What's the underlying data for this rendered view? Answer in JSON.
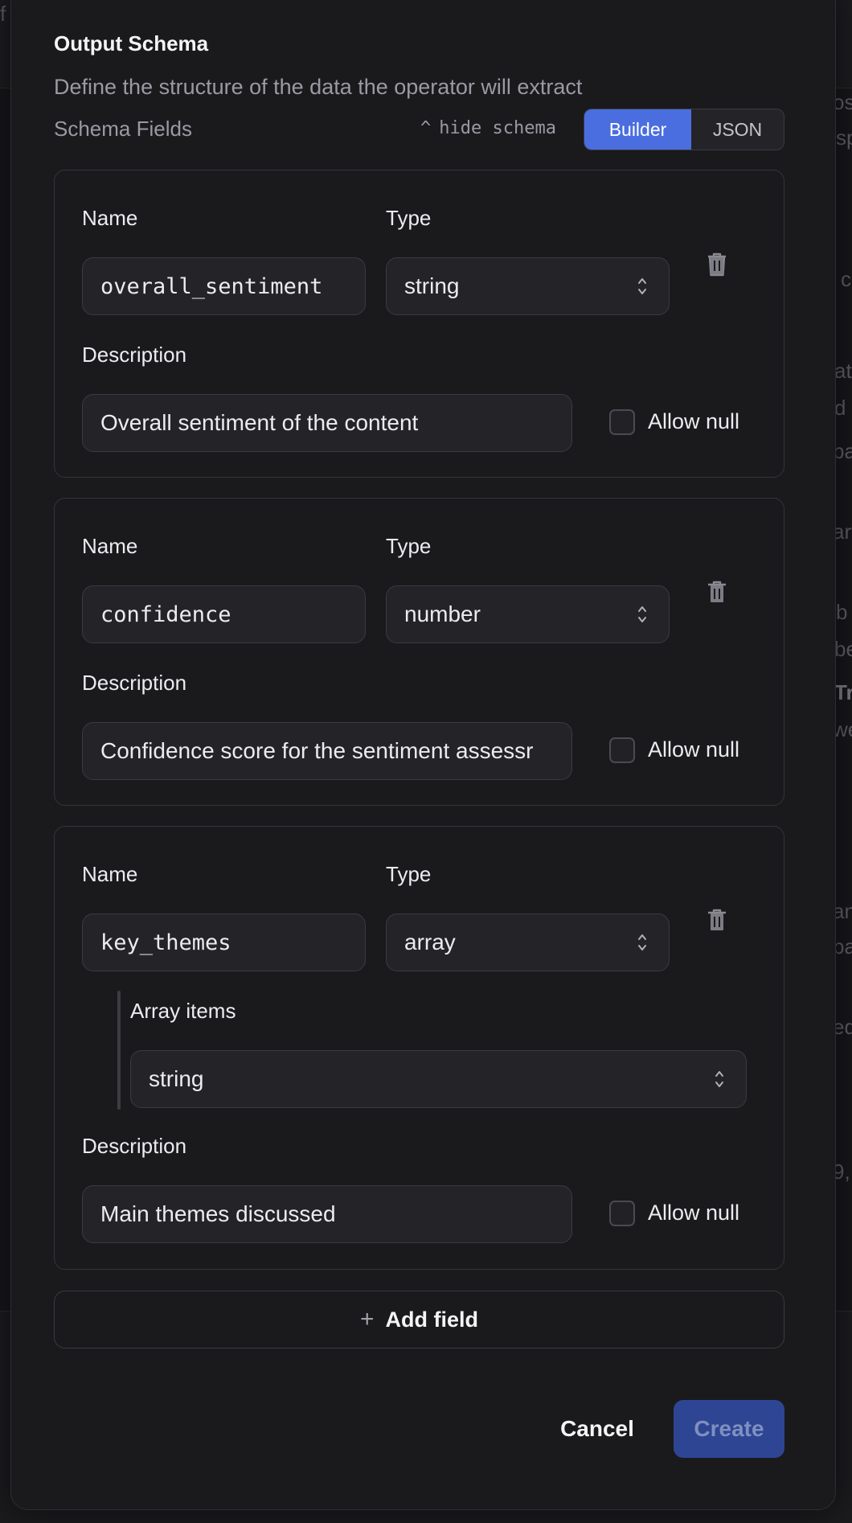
{
  "background": {
    "fragments": [
      "f",
      "os",
      "sp",
      "c",
      "at",
      "d",
      "pa",
      "art",
      "b",
      "be",
      "Tr",
      "we",
      "an",
      "pa",
      "ed",
      "9,"
    ]
  },
  "schema": {
    "title": "Output Schema",
    "description": "Define the structure of the data the operator will extract",
    "fields_label": "Schema Fields",
    "hide_schema": "hide schema",
    "hide_caret": "^",
    "modes": {
      "builder": "Builder",
      "json": "JSON",
      "active": "Builder"
    }
  },
  "labels": {
    "name": "Name",
    "type": "Type",
    "description": "Description",
    "allow_null": "Allow null",
    "array_items": "Array items"
  },
  "fields": [
    {
      "name": "overall_sentiment",
      "type": "string",
      "description": "Overall sentiment of the content",
      "allow_null": false
    },
    {
      "name": "confidence",
      "type": "number",
      "description": "Confidence score for the sentiment assessr",
      "allow_null": false
    },
    {
      "name": "key_themes",
      "type": "array",
      "array_items_type": "string",
      "description": "Main themes discussed",
      "allow_null": false
    }
  ],
  "actions": {
    "add_field": "Add field",
    "add_icon": "+",
    "cancel": "Cancel",
    "create": "Create"
  },
  "colors": {
    "accent": "#4a6ee0",
    "create_disabled": "#2d4593",
    "modal_bg": "#1a1a1d"
  }
}
